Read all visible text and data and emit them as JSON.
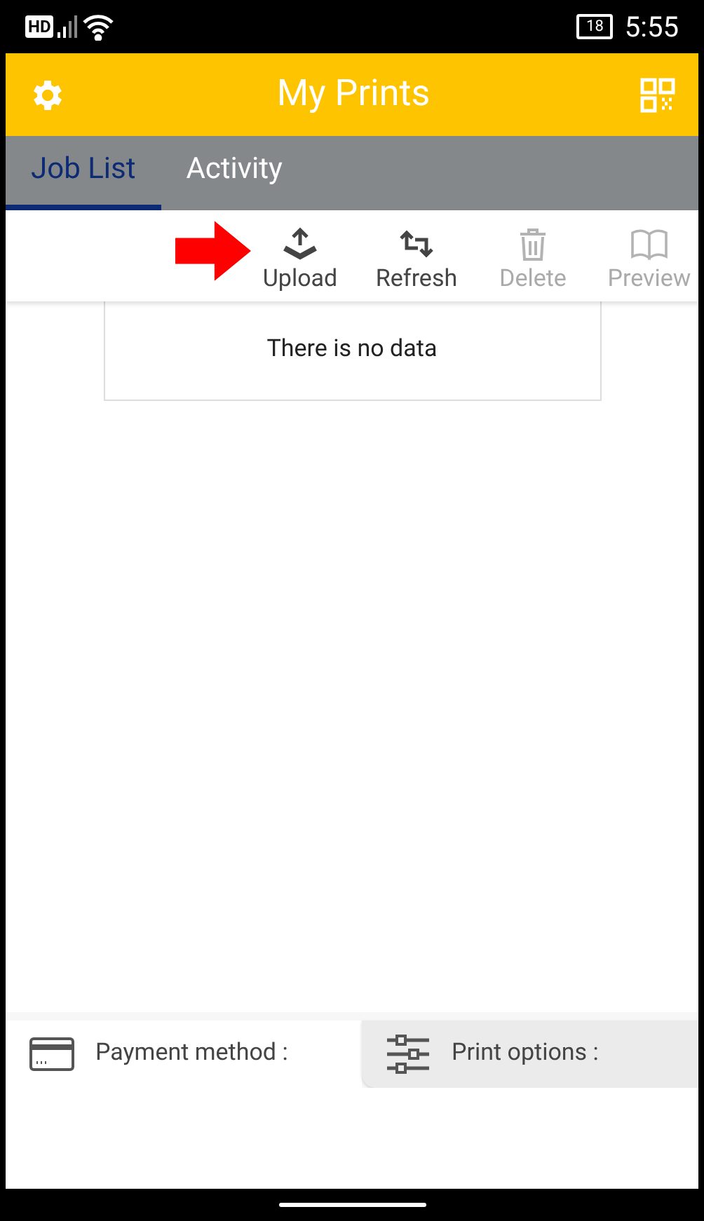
{
  "status_bar": {
    "network": "HD",
    "battery": "18",
    "time": "5:55"
  },
  "header": {
    "title": "My Prints"
  },
  "tabs": [
    {
      "label": "Job List",
      "selected": true
    },
    {
      "label": "Activity",
      "selected": false
    }
  ],
  "toolbar": [
    {
      "kind": "upload",
      "label": "Upload",
      "disabled": false
    },
    {
      "kind": "refresh",
      "label": "Refresh",
      "disabled": false
    },
    {
      "kind": "delete",
      "label": "Delete",
      "disabled": true
    },
    {
      "kind": "preview",
      "label": "Preview",
      "disabled": true
    }
  ],
  "job_list": {
    "empty_message": "There is no data"
  },
  "bottom_tabs": [
    {
      "kind": "payment",
      "label": "Payment method :",
      "selected": true
    },
    {
      "kind": "options",
      "label": "Print options :",
      "selected": false
    }
  ]
}
